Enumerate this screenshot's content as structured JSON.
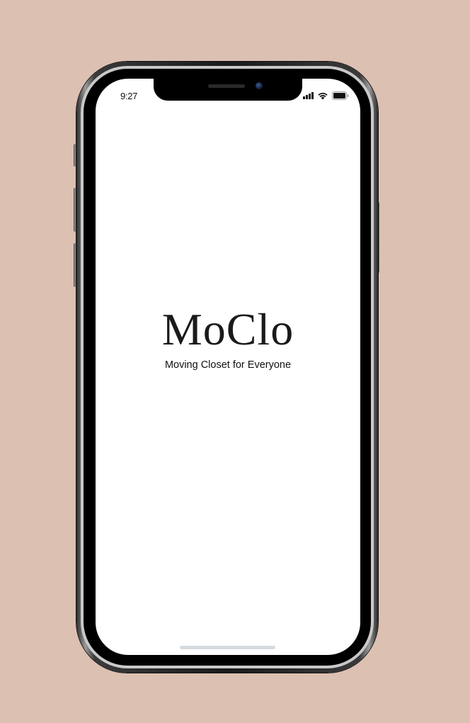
{
  "status_bar": {
    "time": "9:27",
    "signal_icon": "cellular-signal-icon",
    "wifi_icon": "wifi-icon",
    "battery_icon": "battery-icon"
  },
  "splash": {
    "app_name": "MoClo",
    "tagline": "Moving Closet for Everyone"
  },
  "colors": {
    "background": "#dcc0b2",
    "screen": "#ffffff",
    "text": "#1a1a1a",
    "home_indicator": "#d6dbe0"
  }
}
